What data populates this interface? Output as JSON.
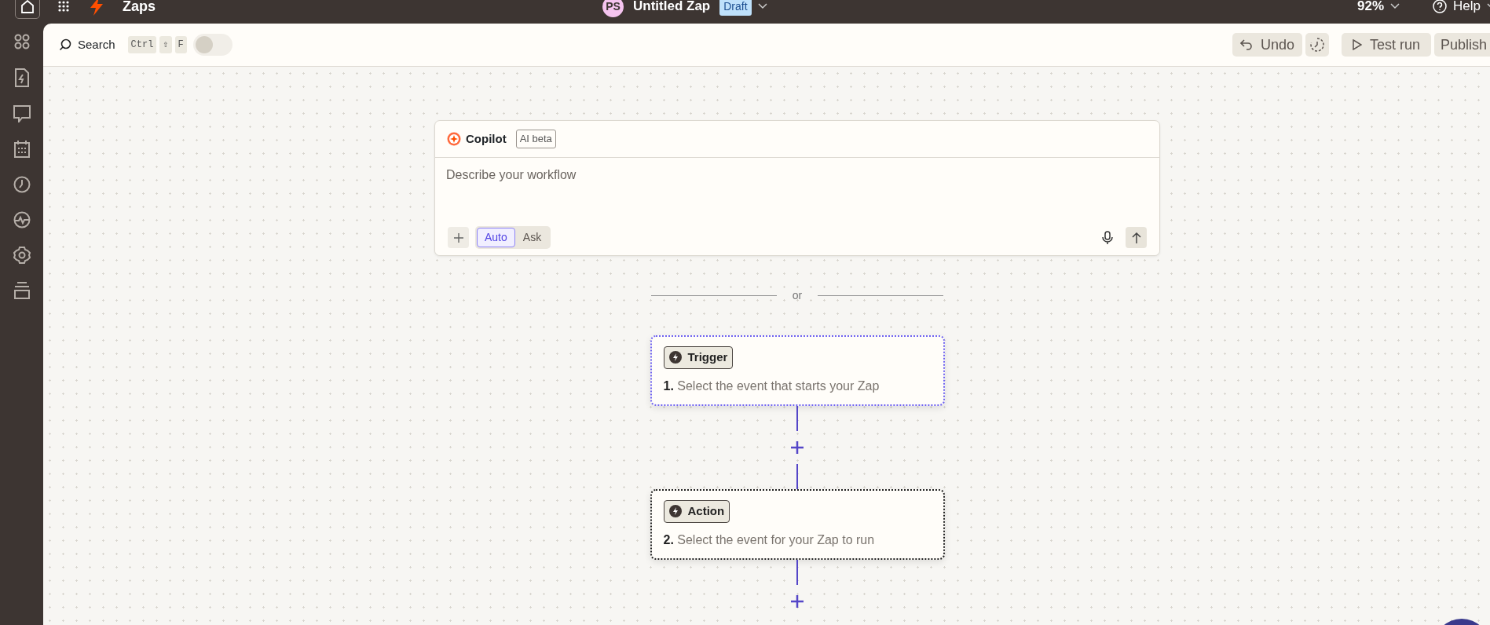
{
  "topbar": {
    "app_title": "Zaps",
    "avatar": "PS",
    "zap_title": "Untitled Zap",
    "status_badge": "Draft",
    "zoom": "92%",
    "help": "Help"
  },
  "toolbar": {
    "search": "Search",
    "shortcut_keys": [
      "Ctrl",
      "⇧",
      "F"
    ],
    "toggle_on": false,
    "undo": "Undo",
    "test_run": "Test run",
    "publish": "Publish"
  },
  "copilot": {
    "title": "Copilot",
    "badge": "AI beta",
    "placeholder": "Describe your workflow",
    "modes": [
      {
        "label": "Auto",
        "selected": true
      },
      {
        "label": "Ask",
        "selected": false
      }
    ]
  },
  "divider": "or",
  "steps": [
    {
      "tag": "Trigger",
      "number": "1.",
      "text": "Select the event that starts your Zap",
      "selected": true
    },
    {
      "tag": "Action",
      "number": "2.",
      "text": "Select the event for your Zap to run",
      "selected": false
    }
  ]
}
